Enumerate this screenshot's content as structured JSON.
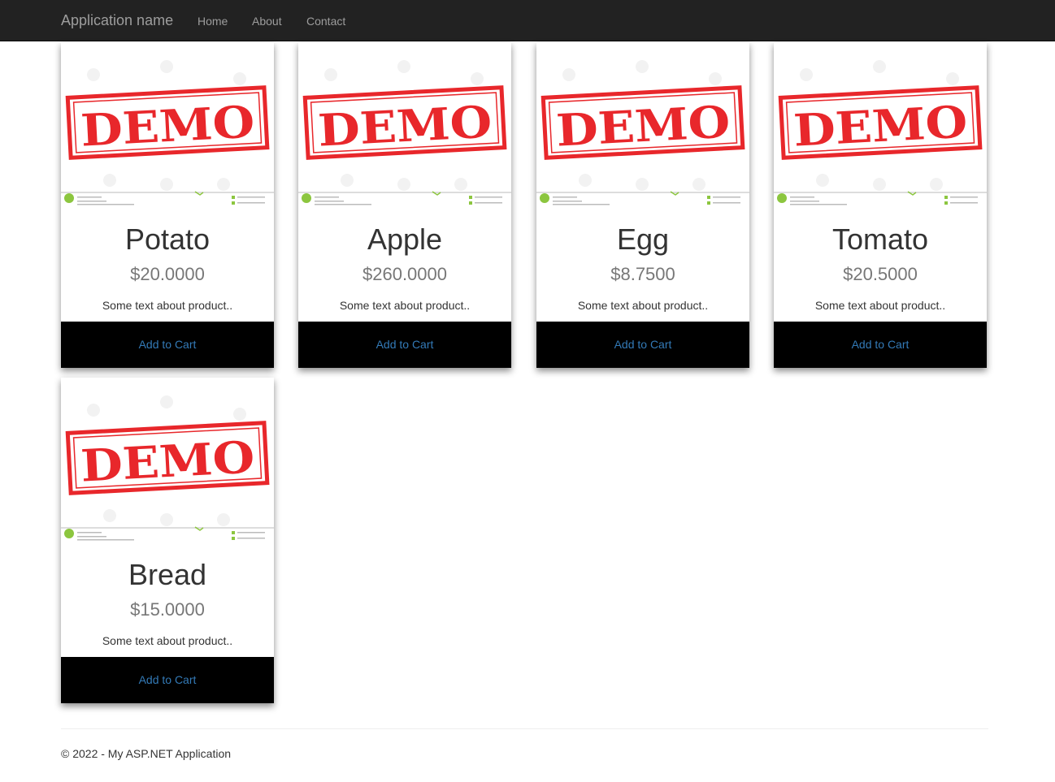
{
  "navbar": {
    "brand": "Application name",
    "links": [
      "Home",
      "About",
      "Contact"
    ]
  },
  "products": [
    {
      "name": "Potato",
      "price": "$20.0000",
      "description": "Some text about product..",
      "button": "Add to Cart",
      "image_text": "DEMO"
    },
    {
      "name": "Apple",
      "price": "$260.0000",
      "description": "Some text about product..",
      "button": "Add to Cart",
      "image_text": "DEMO"
    },
    {
      "name": "Egg",
      "price": "$8.7500",
      "description": "Some text about product..",
      "button": "Add to Cart",
      "image_text": "DEMO"
    },
    {
      "name": "Tomato",
      "price": "$20.5000",
      "description": "Some text about product..",
      "button": "Add to Cart",
      "image_text": "DEMO"
    },
    {
      "name": "Bread",
      "price": "$15.0000",
      "description": "Some text about product..",
      "button": "Add to Cart",
      "image_text": "DEMO"
    }
  ],
  "footer": {
    "text": "© 2022 - My ASP.NET Application"
  },
  "colors": {
    "navbar_bg": "#222222",
    "nav_text": "#9d9d9d",
    "button_bg": "#000000",
    "button_text": "#337ab7",
    "stamp_red": "#e8272b"
  }
}
